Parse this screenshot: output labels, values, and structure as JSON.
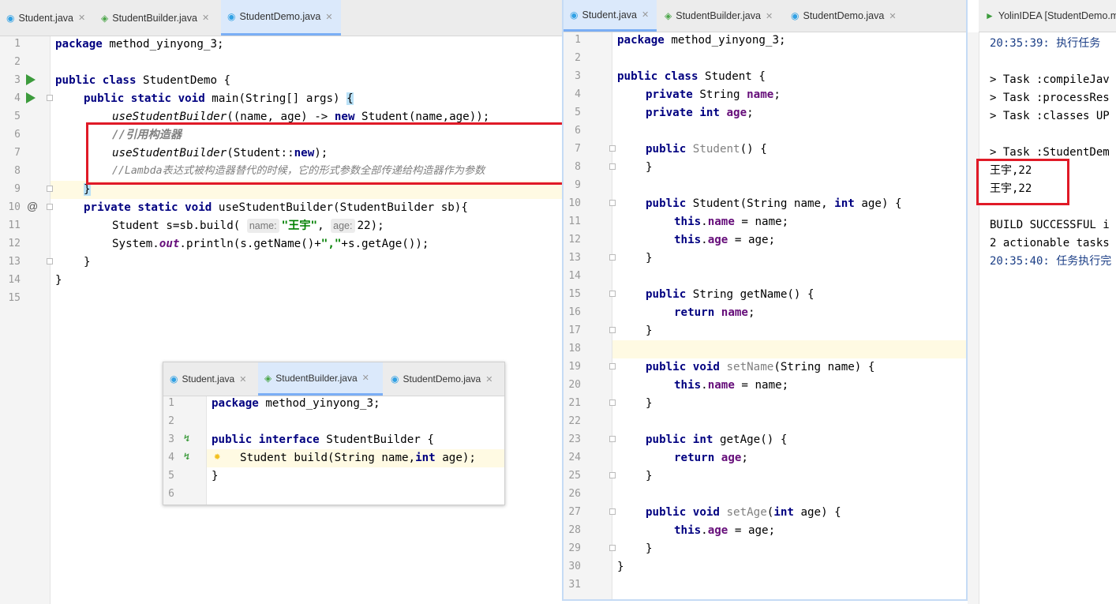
{
  "left_editor": {
    "tabs": [
      {
        "label": "Student.java",
        "icon": "class-icon"
      },
      {
        "label": "StudentBuilder.java",
        "icon": "interface-icon"
      },
      {
        "label": "StudentDemo.java",
        "icon": "class-icon",
        "active": true
      }
    ],
    "line_numbers": [
      "1",
      "2",
      "3",
      "4",
      "5",
      "6",
      "7",
      "8",
      "9",
      "10",
      "11",
      "12",
      "13",
      "14",
      "15"
    ],
    "code": {
      "l1_kw": "package",
      "l1_rest": " method_yinyong_3;",
      "l3_kw": "public class",
      "l3_rest": " StudentDemo {",
      "l4_kw": "public static void",
      "l4_rest": " main(String[] args) ",
      "l4_brace": "{",
      "l5_call": "useStudentBuilder",
      "l5_a": "((name, age) -> ",
      "l5_kw": "new",
      "l5_b": " Student(name,age));",
      "l6_comment": "//引用构造器",
      "l7_call": "useStudentBuilder",
      "l7_a": "(Student::",
      "l7_kw": "new",
      "l7_b": ");",
      "l8_comment": "//Lambda表达式被构造器替代的时候，它的形式参数全部传递给构造器作为参数",
      "l9_brace": "}",
      "l10_kw": "private static void",
      "l10_rest": " useStudentBuilder(StudentBuilder sb){",
      "l11_a": "Student s=sb.build( ",
      "l11_hint1": "name:",
      "l11_str": "\"王宇\"",
      "l11_b": ", ",
      "l11_hint2": "age:",
      "l11_c": "22);",
      "l12_a": "System.",
      "l12_out": "out",
      "l12_b": ".println(s.getName()+",
      "l12_str": "\",\"",
      "l12_c": "+s.getAge());",
      "l13": "}",
      "l14": "}"
    }
  },
  "popup_editor": {
    "tabs": [
      {
        "label": "Student.java",
        "icon": "class-icon"
      },
      {
        "label": "StudentBuilder.java",
        "icon": "interface-icon",
        "active": true
      },
      {
        "label": "StudentDemo.java",
        "icon": "class-icon"
      }
    ],
    "line_numbers": [
      "1",
      "2",
      "3",
      "4",
      "5",
      "6"
    ],
    "code": {
      "l1_kw": "package",
      "l1_rest": " method_yinyong_3;",
      "l3_kw": "public interface",
      "l3_rest": " StudentBuilder {",
      "l4_a": "Student build(String name,",
      "l4_kw": "int",
      "l4_b": " age);",
      "l5": "}"
    }
  },
  "right_editor": {
    "tabs": [
      {
        "label": "Student.java",
        "icon": "class-icon",
        "active": true
      },
      {
        "label": "StudentBuilder.java",
        "icon": "interface-icon"
      },
      {
        "label": "StudentDemo.java",
        "icon": "class-icon"
      }
    ],
    "line_numbers": [
      "1",
      "2",
      "3",
      "4",
      "5",
      "6",
      "7",
      "8",
      "9",
      "10",
      "11",
      "12",
      "13",
      "14",
      "15",
      "16",
      "17",
      "18",
      "19",
      "20",
      "21",
      "22",
      "23",
      "24",
      "25",
      "26",
      "27",
      "28",
      "29",
      "30",
      "31"
    ],
    "code": {
      "l1_kw": "package",
      "l1_rest": " method_yinyong_3;",
      "l3_kw": "public class",
      "l3_rest": " Student {",
      "l4_kw": "private",
      "l4_a": " String ",
      "l4_f": "name",
      "l4_b": ";",
      "l5_kw": "private int",
      "l5_a": " ",
      "l5_f": "age",
      "l5_b": ";",
      "l7_kw": "public",
      "l7_a": " ",
      "l7_u": "Student",
      "l7_b": "() {",
      "l8": "}",
      "l10_kw": "public",
      "l10_a": " Student(String name, ",
      "l10_kw2": "int",
      "l10_b": " age) {",
      "l11_kw": "this",
      "l11_a": ".",
      "l11_f": "name",
      "l11_b": " = name;",
      "l12_kw": "this",
      "l12_a": ".",
      "l12_f": "age",
      "l12_b": " = age;",
      "l13": "}",
      "l15_kw": "public",
      "l15_a": " String getName() {",
      "l16_kw": "return",
      "l16_a": " ",
      "l16_f": "name",
      "l16_b": ";",
      "l17": "}",
      "l19_kw": "public void",
      "l19_a": " ",
      "l19_u": "setName",
      "l19_b": "(String name) {",
      "l20_kw": "this",
      "l20_a": ".",
      "l20_f": "name",
      "l20_b": " = name;",
      "l21": "}",
      "l23_kw": "public int",
      "l23_a": " getAge() {",
      "l24_kw": "return",
      "l24_a": " ",
      "l24_f": "age",
      "l24_b": ";",
      "l25": "}",
      "l27_kw": "public void",
      "l27_a": " ",
      "l27_u": "setAge",
      "l27_b": "(",
      "l27_kw2": "int",
      "l27_c": " age) {",
      "l28_kw": "this",
      "l28_a": ".",
      "l28_f": "age",
      "l28_b": " = age;",
      "l29": "}",
      "l30": "}"
    }
  },
  "console": {
    "tab_label": "YolinIDEA [StudentDemo.m",
    "lines": {
      "l1": "20:35:39: 执行任务",
      "l3": "> Task :compileJav",
      "l4": "> Task :processRes",
      "l5": "> Task :classes UP",
      "l7": "> Task :StudentDem",
      "l8": "王宇,22",
      "l9": "王宇,22",
      "l11": "BUILD SUCCESSFUL i",
      "l12": "2 actionable tasks",
      "l13": "20:35:40: 任务执行完"
    }
  },
  "colors": {
    "highlight_box": "#e01a27",
    "run_icon": "#3c9b3c",
    "keyword": "#000080",
    "field": "#660e7a",
    "string": "#008000",
    "active_tab": "#dbe9fb"
  }
}
